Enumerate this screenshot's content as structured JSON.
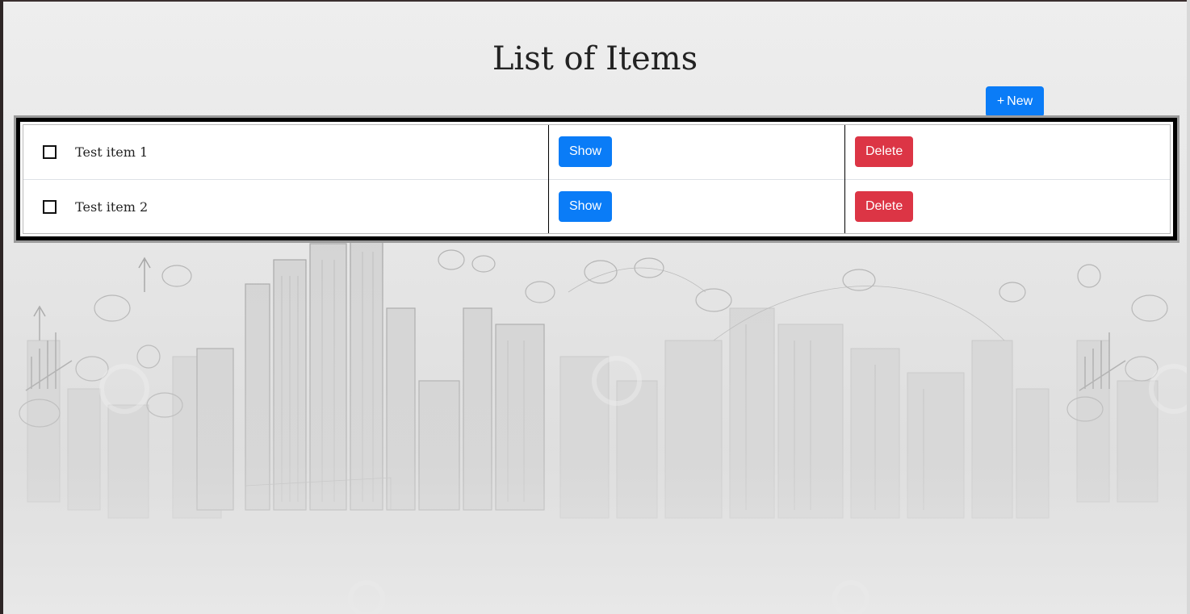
{
  "page": {
    "title": "List of Items"
  },
  "toolbar": {
    "new_icon": "+",
    "new_label": "New"
  },
  "items": [
    {
      "label": "Test item 1",
      "checked": false,
      "show_label": "Show",
      "delete_label": "Delete"
    },
    {
      "label": "Test item 2",
      "checked": false,
      "show_label": "Show",
      "delete_label": "Delete"
    }
  ],
  "colors": {
    "primary": "#0a7cf7",
    "danger": "#dc3545",
    "frame": "#000000"
  },
  "icons": {
    "checkbox": "checkbox-icon"
  }
}
